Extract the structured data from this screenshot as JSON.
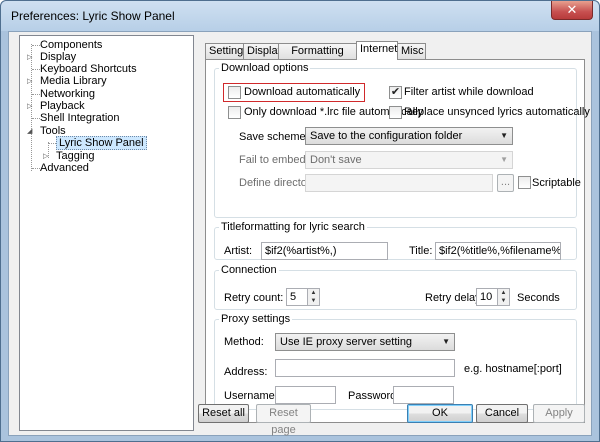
{
  "window": {
    "title": "Preferences: Lyric Show Panel",
    "close_label": "✕"
  },
  "tree": [
    {
      "label": "Components",
      "arrow": ""
    },
    {
      "label": "Display",
      "arrow": "▷"
    },
    {
      "label": "Keyboard Shortcuts",
      "arrow": ""
    },
    {
      "label": "Media Library",
      "arrow": "▷"
    },
    {
      "label": "Networking",
      "arrow": ""
    },
    {
      "label": "Playback",
      "arrow": "▷"
    },
    {
      "label": "Shell Integration",
      "arrow": ""
    },
    {
      "label": "Tools",
      "arrow": "◢"
    },
    {
      "label": "Lyric Show Panel",
      "arrow": ""
    },
    {
      "label": "Tagging",
      "arrow": "▷"
    },
    {
      "label": "Advanced",
      "arrow": ""
    }
  ],
  "tabs": [
    "Setting",
    "Display",
    "Formatting string",
    "Internet",
    "Misc"
  ],
  "download_options": {
    "legend": "Download options",
    "download_auto": {
      "label": "Download automatically",
      "checked": false
    },
    "filter_artist": {
      "label": "Filter artist while download",
      "checked": true
    },
    "only_lrc": {
      "label": "Only download *.lrc file automatically",
      "checked": false
    },
    "replace_unsynced": {
      "label": "Replace unsynced lyrics automatically",
      "checked": false
    },
    "save_scheme_label": "Save scheme:",
    "save_scheme_value": "Save to the configuration folder",
    "fail_embed_label": "Fail to embed:",
    "fail_embed_value": "Don't save",
    "define_dir_label": "Define directory:",
    "define_dir_value": "",
    "browse_label": "...",
    "scriptable": {
      "label": "Scriptable",
      "checked": false
    }
  },
  "titleformatting": {
    "legend": "Titleformatting for lyric search",
    "artist_label": "Artist:",
    "artist_value": "$if2(%artist%,)",
    "title_label": "Title:",
    "title_value": "$if2(%title%,%filename%)"
  },
  "connection": {
    "legend": "Connection",
    "retry_count_label": "Retry count:",
    "retry_count_value": "5",
    "retry_delay_label": "Retry delay:",
    "retry_delay_value": "10",
    "seconds_label": "Seconds"
  },
  "proxy": {
    "legend": "Proxy settings",
    "method_label": "Method:",
    "method_value": "Use IE proxy server setting",
    "address_label": "Address:",
    "address_value": "",
    "address_hint": "e.g. hostname[:port]",
    "username_label": "Username:",
    "username_value": "",
    "password_label": "Password:",
    "password_value": ""
  },
  "buttons": {
    "reset_all": "Reset all",
    "reset_page": "Reset page",
    "ok": "OK",
    "cancel": "Cancel",
    "apply": "Apply"
  },
  "colors": {
    "highlight": "#d0292b",
    "titlebar": "#b7cfe7",
    "close": "#c75050"
  }
}
